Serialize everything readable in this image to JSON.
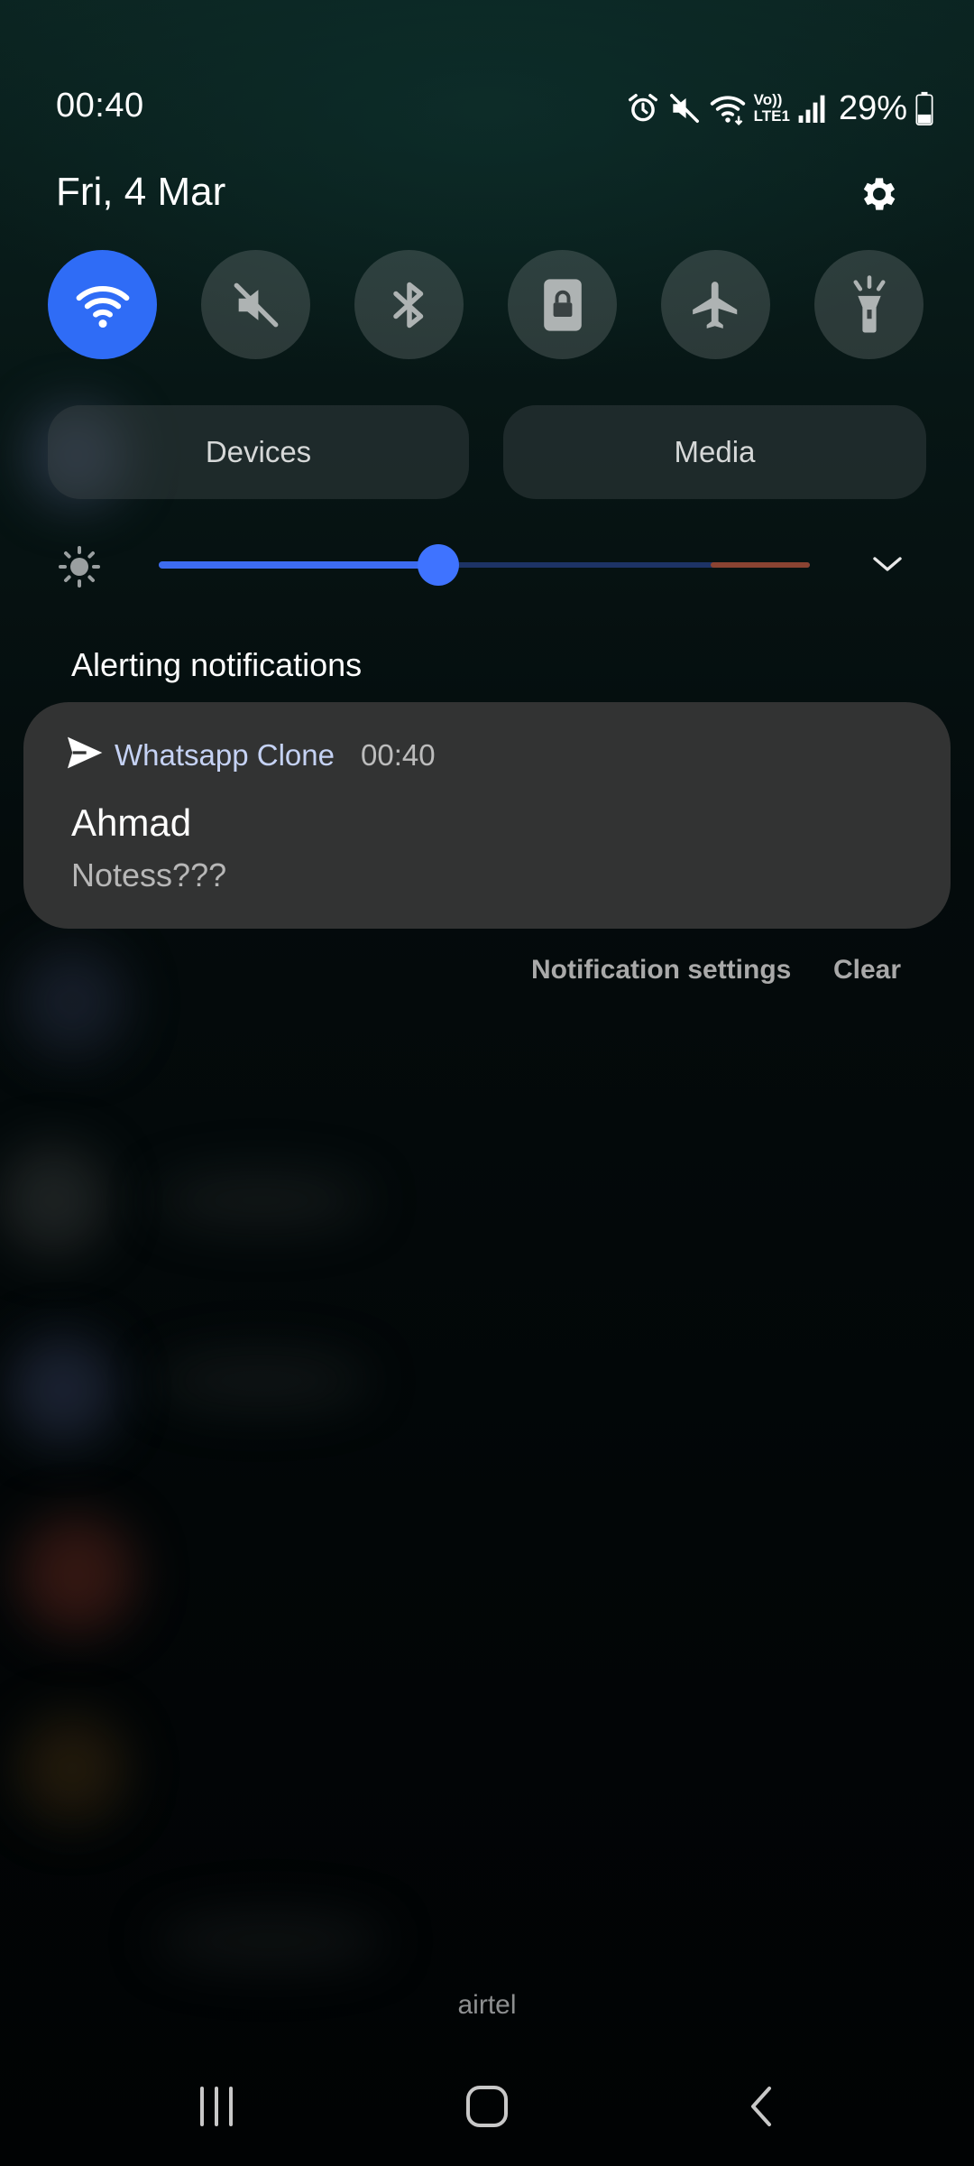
{
  "status_bar": {
    "time": "00:40",
    "battery": "29%",
    "icons": [
      "alarm-icon",
      "mute-icon",
      "wifi-icon",
      "volte-lte-icon",
      "signal-icon",
      "battery-icon"
    ],
    "volte_label": "Vo))",
    "lte_label": "LTE1"
  },
  "header": {
    "date": "Fri, 4 Mar",
    "settings_icon": "gear-icon"
  },
  "quick_toggles": [
    {
      "name": "wifi",
      "icon": "wifi-icon",
      "active": true
    },
    {
      "name": "sound",
      "icon": "mute-icon",
      "active": false
    },
    {
      "name": "bluetooth",
      "icon": "bluetooth-icon",
      "active": false
    },
    {
      "name": "rotation-lock",
      "icon": "lock-icon",
      "active": false
    },
    {
      "name": "airplane-mode",
      "icon": "airplane-icon",
      "active": false
    },
    {
      "name": "flashlight",
      "icon": "flashlight-icon",
      "active": false
    }
  ],
  "pills": {
    "devices": "Devices",
    "media": "Media"
  },
  "brightness": {
    "level_fraction": 0.43
  },
  "notifications": {
    "section_title": "Alerting notifications",
    "items": [
      {
        "app_name": "Whatsapp Clone",
        "time": "00:40",
        "sender": "Ahmad",
        "message": "Notess???"
      }
    ],
    "settings_label": "Notification settings",
    "clear_label": "Clear"
  },
  "carrier": "airtel",
  "colors": {
    "accent": "#2f6cf6",
    "card_bg": "#323333",
    "app_name": "#c5d2f4"
  }
}
